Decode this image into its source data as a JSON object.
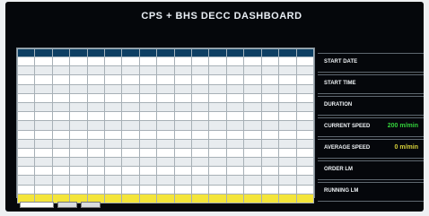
{
  "title": "CPS + BHS DECC DASHBOARD",
  "coil_label": "",
  "table": {
    "columns": [
      "",
      "",
      "",
      "",
      "",
      "",
      "",
      "",
      "",
      "",
      "",
      "",
      "",
      "",
      "",
      "",
      ""
    ],
    "rows": [
      [
        "",
        "",
        "",
        "",
        "",
        "",
        "",
        "",
        "",
        "",
        "",
        "",
        "",
        "",
        "",
        "",
        ""
      ],
      [
        "",
        "",
        "",
        "",
        "",
        "",
        "",
        "",
        "",
        "",
        "",
        "",
        "",
        "",
        "",
        "",
        ""
      ],
      [
        "",
        "",
        "",
        "",
        "",
        "",
        "",
        "",
        "",
        "",
        "",
        "",
        "",
        "",
        "",
        "",
        ""
      ],
      [
        "",
        "",
        "",
        "",
        "",
        "",
        "",
        "",
        "",
        "",
        "",
        "",
        "",
        "",
        "",
        "",
        ""
      ],
      [
        "",
        "",
        "",
        "",
        "",
        "",
        "",
        "",
        "",
        "",
        "",
        "",
        "",
        "",
        "",
        "",
        ""
      ],
      [
        "",
        "",
        "",
        "",
        "",
        "",
        "",
        "",
        "",
        "",
        "",
        "",
        "",
        "",
        "",
        "",
        ""
      ],
      [
        "",
        "",
        "",
        "",
        "",
        "",
        "",
        "",
        "",
        "",
        "",
        "",
        "",
        "",
        "",
        "",
        ""
      ],
      [
        "",
        "",
        "",
        "",
        "",
        "",
        "",
        "",
        "",
        "",
        "",
        "",
        "",
        "",
        "",
        "",
        ""
      ],
      [
        "",
        "",
        "",
        "",
        "",
        "",
        "",
        "",
        "",
        "",
        "",
        "",
        "",
        "",
        "",
        "",
        ""
      ],
      [
        "",
        "",
        "",
        "",
        "",
        "",
        "",
        "",
        "",
        "",
        "",
        "",
        "",
        "",
        "",
        "",
        ""
      ],
      [
        "",
        "",
        "",
        "",
        "",
        "",
        "",
        "",
        "",
        "",
        "",
        "",
        "",
        "",
        "",
        "",
        ""
      ],
      [
        "",
        "",
        "",
        "",
        "",
        "",
        "",
        "",
        "",
        "",
        "",
        "",
        "",
        "",
        "",
        "",
        ""
      ],
      [
        "",
        "",
        "",
        "",
        "",
        "",
        "",
        "",
        "",
        "",
        "",
        "",
        "",
        "",
        "",
        "",
        ""
      ],
      [
        "",
        "",
        "",
        "",
        "",
        "",
        "",
        "",
        "",
        "",
        "",
        "",
        "",
        "",
        "",
        "",
        ""
      ],
      [
        "",
        "",
        "",
        "",
        "",
        "",
        "",
        "",
        "",
        "",
        "",
        "",
        "",
        "",
        "",
        "",
        ""
      ],
      [
        "",
        "",
        "",
        "",
        "",
        "",
        "",
        "",
        "",
        "",
        "",
        "",
        "",
        "",
        "",
        "",
        ""
      ]
    ],
    "highlight_row": 15
  },
  "controls": {
    "date_label": "",
    "button1": "",
    "button2": ""
  },
  "panel": {
    "date_line": "",
    "rows": [
      {
        "label": "START DATE",
        "value": "",
        "color": "#ffffff"
      },
      {
        "label": "START TIME",
        "value": "",
        "color": "#ffffff"
      },
      {
        "label": "DURATION",
        "value": "",
        "color": "#ffffff"
      },
      {
        "label": "CURRENT SPEED",
        "value": "200 m/min",
        "color": "#34d23b"
      },
      {
        "label": "AVERAGE SPEED",
        "value": "0 m/min",
        "color": "#d8d23a"
      },
      {
        "label": "ORDER LM",
        "value": "",
        "color": "#2aa8e0"
      },
      {
        "label": "RUNNING LM",
        "value": "",
        "color": "#e8433f"
      }
    ]
  },
  "footnote": "",
  "colors": {
    "header": "#0d3f63",
    "highlight": "#f4e53a",
    "screen": "#05070b"
  }
}
